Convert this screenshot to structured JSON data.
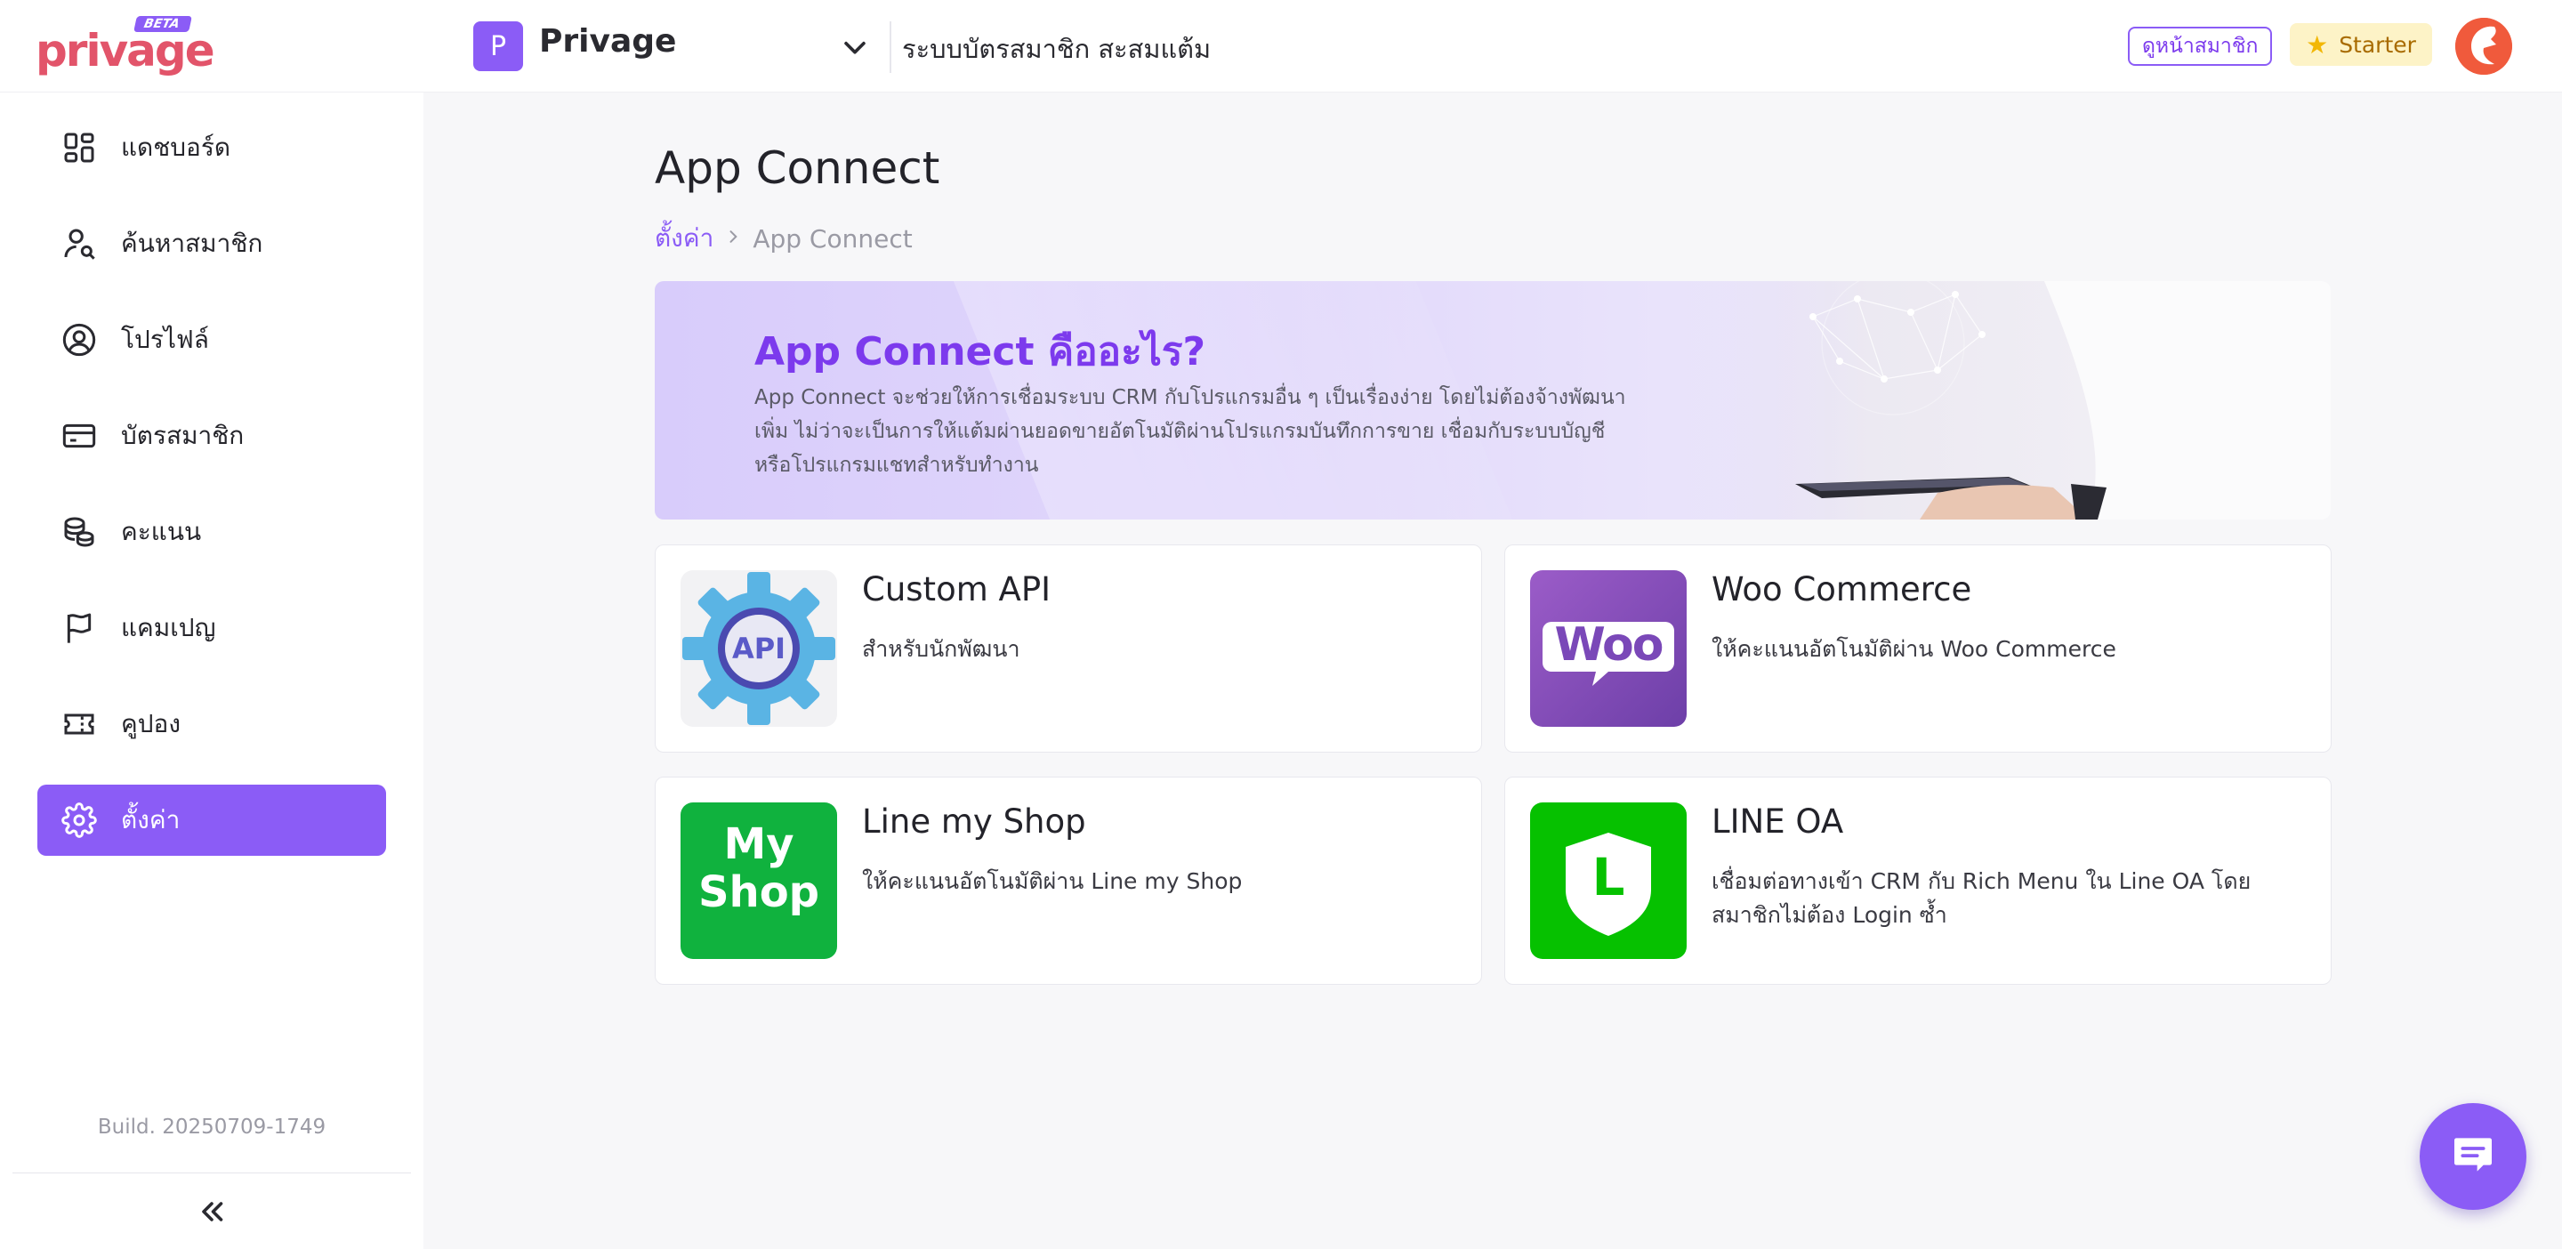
{
  "header": {
    "logo_text": "privage",
    "logo_badge": "BETA",
    "org_initial": "P",
    "org_name": "Privage",
    "system_name": "ระบบบัตรสมาชิก สะสมแต้ม",
    "view_member_label": "ดูหน้าสมาชิก",
    "plan_label": "Starter",
    "colors": {
      "accent": "#8b5cf6",
      "logo": "#e2546a"
    }
  },
  "sidebar": {
    "items": [
      {
        "label": "แดชบอร์ด",
        "icon": "dashboard-icon",
        "active": false
      },
      {
        "label": "ค้นหาสมาชิก",
        "icon": "user-search-icon",
        "active": false
      },
      {
        "label": "โปรไฟล์",
        "icon": "profile-icon",
        "active": false
      },
      {
        "label": "บัตรสมาชิก",
        "icon": "card-icon",
        "active": false
      },
      {
        "label": "คะแนน",
        "icon": "coins-icon",
        "active": false
      },
      {
        "label": "แคมเปญ",
        "icon": "flag-icon",
        "active": false
      },
      {
        "label": "คูปอง",
        "icon": "ticket-icon",
        "active": false
      },
      {
        "label": "ตั้งค่า",
        "icon": "gear-icon",
        "active": true
      }
    ],
    "build": "Build. 20250709-1749"
  },
  "main": {
    "title": "App Connect",
    "breadcrumb": {
      "parent": "ตั้งค่า",
      "current": "App Connect"
    },
    "banner": {
      "title": "App Connect คืออะไร?",
      "description": "App Connect จะช่วยให้การเชื่อมระบบ CRM กับโปรแกรมอื่น ๆ เป็นเรื่องง่าย โดยไม่ต้องจ้างพัฒนาเพิ่ม ไม่ว่าจะเป็นการให้แต้มผ่านยอดขายอัตโนมัติผ่านโปรแกรมบันทึกการขาย เชื่อมกับระบบบัญชี หรือโปรแกรมแชทสำหรับทำงาน"
    },
    "apps": [
      {
        "title": "Custom API",
        "description": "สำหรับนักพัฒนา",
        "icon": "api-gear-icon",
        "icon_text": "API"
      },
      {
        "title": "Woo Commerce",
        "description": "ให้คะแนนอัตโนมัติผ่าน Woo Commerce",
        "icon": "woo-logo-icon",
        "icon_text": "Woo"
      },
      {
        "title": "Line my Shop",
        "description": "ให้คะแนนอัตโนมัติผ่าน Line my Shop",
        "icon": "myshop-logo-icon",
        "icon_text": "My Shop"
      },
      {
        "title": "LINE OA",
        "description": "เชื่อมต่อทางเข้า CRM กับ Rich Menu ใน Line OA โดยสมาชิกไม่ต้อง Login ซ้ำ",
        "icon": "line-oa-logo-icon",
        "icon_text": "L"
      }
    ]
  }
}
